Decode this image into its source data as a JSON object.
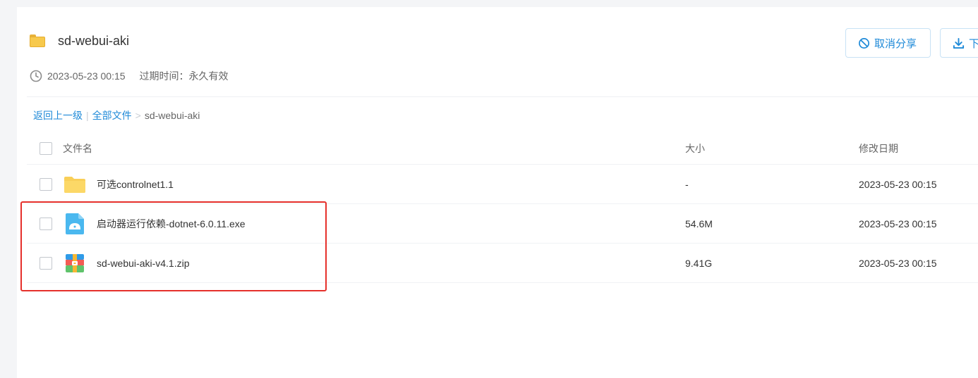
{
  "share": {
    "title": "sd-webui-aki",
    "date": "2023-05-23 00:15",
    "expire_label": "过期时间：永久有效"
  },
  "actions": {
    "cancel_share": "取消分享",
    "download": "下"
  },
  "breadcrumb": {
    "back": "返回上一级",
    "sep1": "|",
    "all_files": "全部文件",
    "sep2": ">",
    "current": "sd-webui-aki"
  },
  "table": {
    "headers": {
      "name": "文件名",
      "size": "大小",
      "modified": "修改日期"
    },
    "rows": [
      {
        "name": "可选controlnet1.1",
        "size": "-",
        "modified": "2023-05-23 00:15",
        "icon": "folder-icon"
      },
      {
        "name": "启动器运行依赖-dotnet-6.0.11.exe",
        "size": "54.6M",
        "modified": "2023-05-23 00:15",
        "icon": "exe-file-icon"
      },
      {
        "name": "sd-webui-aki-v4.1.zip",
        "size": "9.41G",
        "modified": "2023-05-23 00:15",
        "icon": "zip-file-icon"
      }
    ]
  },
  "colors": {
    "accent": "#1f8ad8",
    "highlight": "#e5302b",
    "folder": "#f7c94c"
  }
}
